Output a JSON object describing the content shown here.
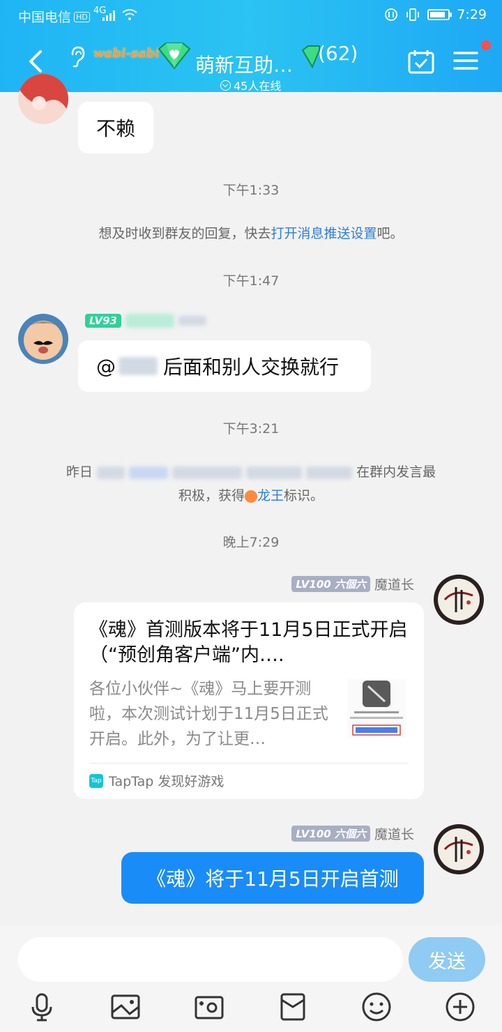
{
  "status": {
    "carrier": "中国电信",
    "hd": "HD",
    "network": "4G",
    "time": "7:29",
    "battery_level": 0.85
  },
  "header": {
    "badge_text": "wabi-sabi",
    "title": "萌新互助…",
    "member_count": "(62)",
    "online": "45人在线",
    "accent": "#1fb5f5"
  },
  "messages": {
    "msg1": "不赖",
    "time1": "下午1:33",
    "sys1_pre": "想及时收到群友的回复，快去",
    "sys1_link": "打开消息推送设置",
    "sys1_post": "吧。",
    "time2": "下午1:47",
    "lv93": "LV93",
    "msg2": "后面和别人交换就行",
    "time3": "下午3:21",
    "sys2_pre": "昨日",
    "sys2_mid": "在群内发言最",
    "sys2_line2_pre": "积极，获得",
    "sys2_line2_link": "龙王",
    "sys2_line2_post": "标识。",
    "time4": "晚上7:29",
    "sender_level": "LV100",
    "sender_title": "六個六",
    "sender_name": "魔道长",
    "card_title": "《魂》首测版本将于11月5日正式开启（“预创角客户端”内….",
    "card_desc": "各位小伙伴~《魂》马上要开测啦，本次测试计划于11月5日正式开启。此外，为了让更…",
    "card_source": "TapTap 发现好游戏",
    "card_logo": "Tap",
    "my_msg": "《魂》将于11月5日开启首测"
  },
  "input": {
    "send_label": "发送",
    "icons": [
      "microphone-icon",
      "image-icon",
      "camera-icon",
      "red-packet-icon",
      "emoji-icon",
      "plus-icon"
    ]
  }
}
